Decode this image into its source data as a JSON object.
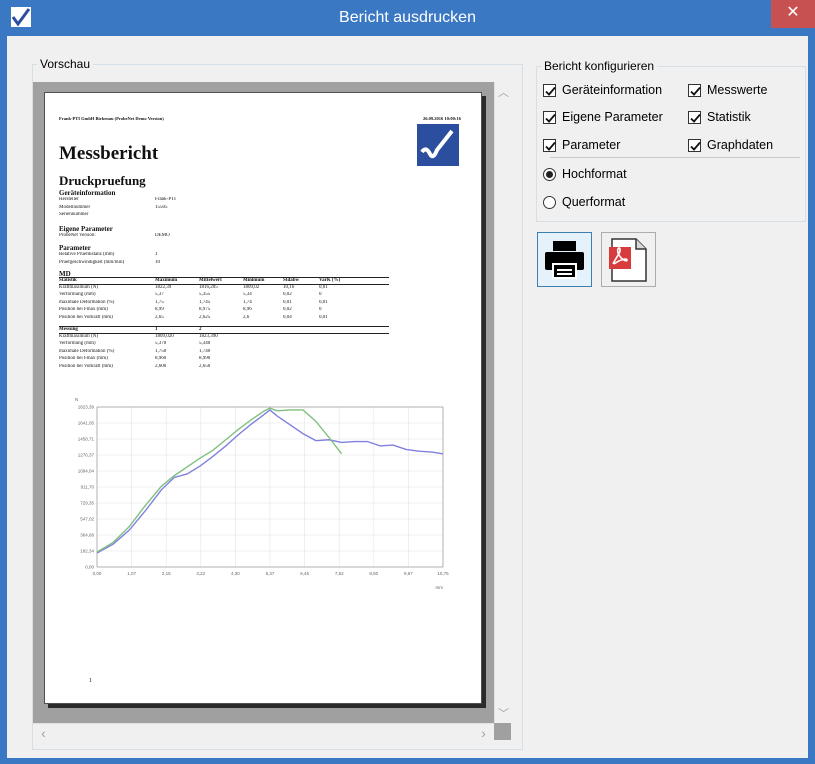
{
  "window": {
    "title": "Bericht ausdrucken",
    "close_glyph": "✕",
    "accent": "#3b78c4"
  },
  "preview": {
    "legend": "Vorschau",
    "page": {
      "header_left": "Frank-PTI GmbH Birkenau (ProbeNet Demo Version)",
      "header_right": "26.09.2016 10:00:16",
      "title": "Messbericht",
      "test_name": "Druckpruefung",
      "device_section": "Geräteinformation",
      "device_rows": [
        {
          "label": "Hersteller",
          "value": "Frank-PTI"
        },
        {
          "label": "Modellnummer",
          "value": "15505"
        },
        {
          "label": "Seriennummer",
          "value": ""
        }
      ],
      "own_section": "Eigene Parameter",
      "own_rows": [
        {
          "label": "ProbeNet Version:",
          "value": "DEMO"
        }
      ],
      "param_section": "Parameter",
      "param_rows": [
        {
          "label": "Relative Pruefdistanz (mm)",
          "value": "1"
        },
        {
          "label": "Pruefgeschwindigkeit (mm/min)",
          "value": "10"
        }
      ],
      "md_label": "MD",
      "stat_header": [
        "Statistik",
        "Maximum",
        "Mittelwert",
        "Minimum",
        "Stdabw",
        "VarK (%)"
      ],
      "stat_rows": [
        [
          "Kraftmaximum (N)",
          "1822,39",
          "1816,205",
          "1809,02",
          "10,16",
          "0,01"
        ],
        [
          "Verformung (mm)",
          "5,37",
          "5,355",
          "5,34",
          "0,02",
          "0"
        ],
        [
          "maximale Deformation (%)",
          "1,75",
          "1,745",
          "1,74",
          "0,01",
          "0,01"
        ],
        [
          "Position bei Fmax (mm)",
          "8,99",
          "8,975",
          "8,96",
          "0,02",
          "0"
        ],
        [
          "Position bei Vorkraft (mm)",
          "2,65",
          "2,625",
          "2,6",
          "0,04",
          "0,01"
        ]
      ],
      "meas_header": [
        "Messung",
        "1",
        "2"
      ],
      "meas_rows": [
        [
          "Kraftmaximum (N)",
          "1809,020",
          "1823,390"
        ],
        [
          "Verformung (mm)",
          "5,370",
          "5,340"
        ],
        [
          "maximale Deformation (%)",
          "1,750",
          "1,740"
        ],
        [
          "Position bei Fmax (mm)",
          "8,960",
          "8,990"
        ],
        [
          "Position bei Vorkraft (mm)",
          "2,600",
          "2,650"
        ]
      ],
      "page_number": "1"
    }
  },
  "chart_data": {
    "type": "line",
    "xlabel": "mm",
    "ylabel": "N",
    "xlim": [
      0,
      10.75
    ],
    "ylim": [
      0,
      1823.39
    ],
    "x_ticks": [
      "0,00",
      "1,07",
      "2,15",
      "3,22",
      "4,30",
      "5,37",
      "6,45",
      "7,52",
      "8,60",
      "9,67",
      "10,75"
    ],
    "y_ticks": [
      "0,00",
      "182,34",
      "364,68",
      "547,02",
      "729,35",
      "911,70",
      "1094,04",
      "1276,37",
      "1458,71",
      "1641,05",
      "1823,39"
    ],
    "series": [
      {
        "color": "#8080e0",
        "x": [
          0,
          0.5,
          1.0,
          1.5,
          2.0,
          2.4,
          2.8,
          3.2,
          3.6,
          4.0,
          4.4,
          4.8,
          5.2,
          5.37,
          5.6,
          6.0,
          6.4,
          6.8,
          7.2,
          7.6,
          8.0,
          8.4,
          8.8,
          9.2,
          9.6,
          10.0,
          10.4,
          10.75
        ],
        "y": [
          160,
          260,
          420,
          640,
          880,
          1020,
          1060,
          1150,
          1260,
          1380,
          1510,
          1630,
          1740,
          1790,
          1720,
          1620,
          1520,
          1440,
          1450,
          1420,
          1430,
          1430,
          1380,
          1390,
          1340,
          1320,
          1310,
          1290
        ]
      },
      {
        "color": "#7fc07f",
        "x": [
          0,
          0.5,
          1.0,
          1.5,
          2.0,
          2.4,
          2.8,
          3.2,
          3.6,
          4.0,
          4.4,
          4.8,
          5.2,
          5.37,
          5.6,
          6.0,
          6.4,
          6.8,
          7.2,
          7.6
        ],
        "y": [
          170,
          280,
          460,
          700,
          920,
          1040,
          1140,
          1240,
          1330,
          1450,
          1570,
          1680,
          1780,
          1810,
          1780,
          1790,
          1790,
          1660,
          1480,
          1290
        ]
      }
    ]
  },
  "config": {
    "legend": "Bericht konfigurieren",
    "checkboxes": [
      {
        "label": "Geräteinformation",
        "checked": true
      },
      {
        "label": "Messwerte",
        "checked": true
      },
      {
        "label": "Eigene Parameter",
        "checked": true
      },
      {
        "label": "Statistik",
        "checked": true
      },
      {
        "label": "Parameter",
        "checked": true
      },
      {
        "label": "Graphdaten",
        "checked": true
      }
    ],
    "orientation": [
      {
        "label": "Hochformat",
        "selected": true
      },
      {
        "label": "Querformat",
        "selected": false
      }
    ]
  },
  "actions": {
    "print_icon": "printer-icon",
    "pdf_icon": "pdf-icon"
  }
}
